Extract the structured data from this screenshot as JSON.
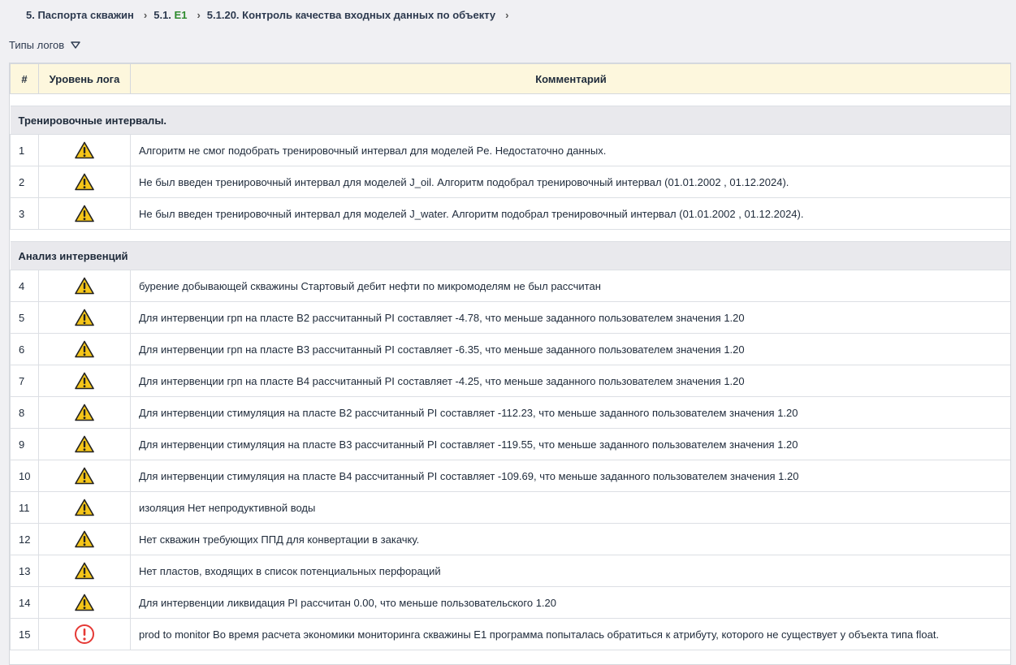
{
  "breadcrumb": {
    "items": [
      {
        "prefix": "5. Паспорта скважин",
        "highlight": ""
      },
      {
        "prefix": "5.1. ",
        "highlight": "E1"
      },
      {
        "prefix": "5.1.20. Контроль качества входных данных по объекту",
        "highlight": ""
      }
    ],
    "separator": "›"
  },
  "filter": {
    "label": "Типы логов"
  },
  "table": {
    "headers": [
      "#",
      "Уровень лога",
      "Комментарий"
    ],
    "groups": [
      {
        "title": "Тренировочные интервалы.",
        "rows": [
          {
            "num": "1",
            "level": "warning",
            "comment": "Алгоритм не смог подобрать тренировочный интервал для моделей Pe. Недостаточно данных."
          },
          {
            "num": "2",
            "level": "warning",
            "comment": "Не был введен тренировочный интервал для моделей J_oil. Алгоритм подобрал тренировочный интервал (01.01.2002 , 01.12.2024)."
          },
          {
            "num": "3",
            "level": "warning",
            "comment": "Не был введен тренировочный интервал для моделей J_water. Алгоритм подобрал тренировочный интервал (01.01.2002 , 01.12.2024)."
          }
        ]
      },
      {
        "title": "Анализ интервенций",
        "rows": [
          {
            "num": "4",
            "level": "warning",
            "comment": "бурение добывающей скважины Стартовый дебит нефти по микромоделям не был рассчитан"
          },
          {
            "num": "5",
            "level": "warning",
            "comment": "Для интервенции грп на пласте B2 рассчитанный PI составляет -4.78, что меньше заданного пользователем значения 1.20"
          },
          {
            "num": "6",
            "level": "warning",
            "comment": "Для интервенции грп на пласте B3 рассчитанный PI составляет -6.35, что меньше заданного пользователем значения 1.20"
          },
          {
            "num": "7",
            "level": "warning",
            "comment": "Для интервенции грп на пласте B4 рассчитанный PI составляет -4.25, что меньше заданного пользователем значения 1.20"
          },
          {
            "num": "8",
            "level": "warning",
            "comment": "Для интервенции стимуляция на пласте B2 рассчитанный PI составляет -112.23, что меньше заданного пользователем значения 1.20"
          },
          {
            "num": "9",
            "level": "warning",
            "comment": "Для интервенции стимуляция на пласте B3 рассчитанный PI составляет -119.55, что меньше заданного пользователем значения 1.20"
          },
          {
            "num": "10",
            "level": "warning",
            "comment": "Для интервенции стимуляция на пласте B4 рассчитанный PI составляет -109.69, что меньше заданного пользователем значения 1.20"
          },
          {
            "num": "11",
            "level": "warning",
            "comment": "изоляция Нет непродуктивной воды"
          },
          {
            "num": "12",
            "level": "warning",
            "comment": "Нет скважин требующих ППД для конвертации в закачку."
          },
          {
            "num": "13",
            "level": "warning",
            "comment": "Нет пластов, входящих в список потенциальных перфораций"
          },
          {
            "num": "14",
            "level": "warning",
            "comment": "Для интервенции ликвидация PI рассчитан 0.00, что меньше пользовательского 1.20"
          },
          {
            "num": "15",
            "level": "error",
            "comment": "prod to monitor Во время расчета экономики мониторинга скважины E1 программа попыталась обратиться к атрибуту, которого не существует у объекта типа float."
          }
        ]
      }
    ]
  },
  "icons": {
    "warning": "warning-triangle-icon",
    "error": "error-circle-icon",
    "filter": "triangle-down-icon"
  },
  "colors": {
    "header_bg": "#fdf7dd",
    "group_bg": "#e9e9ed",
    "warning_fill": "#f5c518",
    "error_stroke": "#e53935",
    "breadcrumb_highlight": "#2e8b2e"
  }
}
